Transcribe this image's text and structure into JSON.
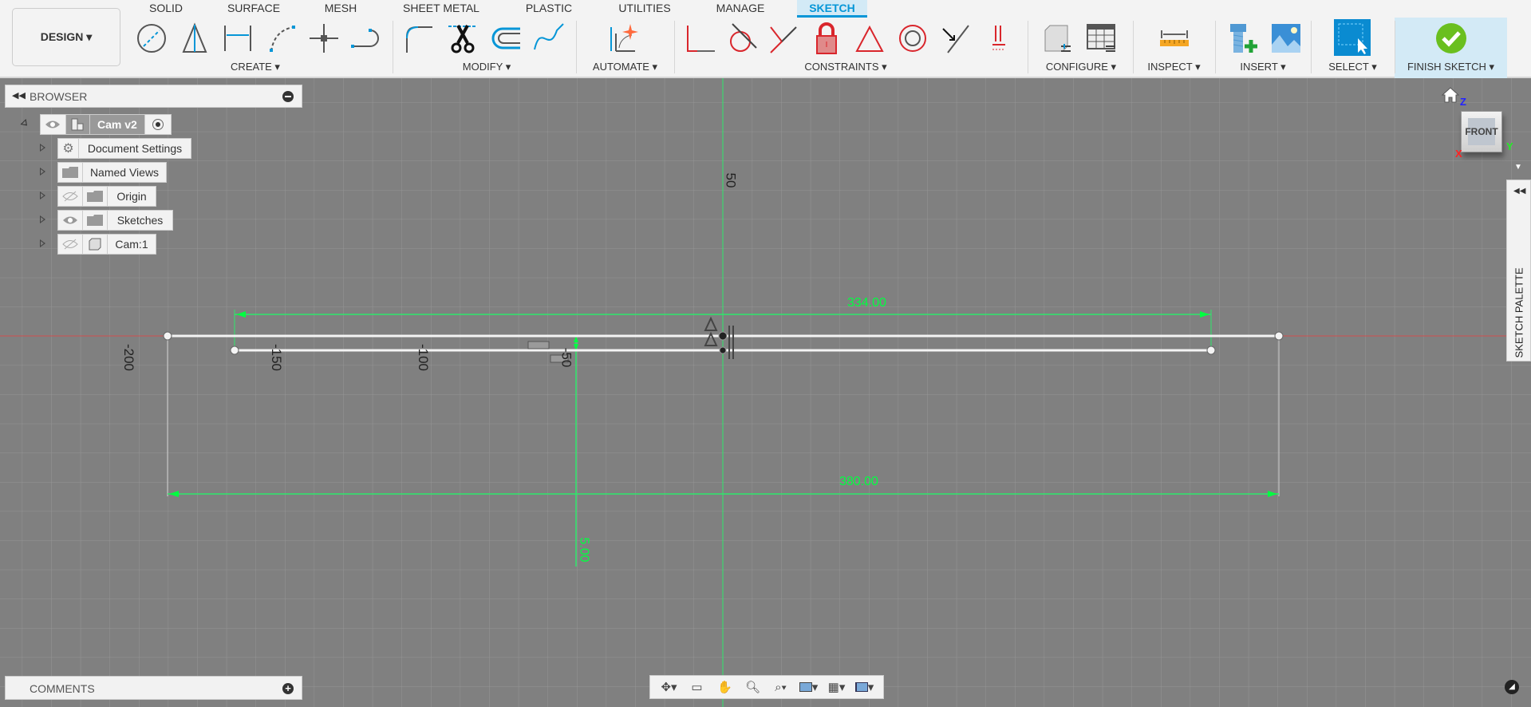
{
  "workspace_button": "DESIGN ▾",
  "tabs": [
    {
      "label": "SOLID"
    },
    {
      "label": "SURFACE"
    },
    {
      "label": "MESH"
    },
    {
      "label": "SHEET METAL"
    },
    {
      "label": "PLASTIC"
    },
    {
      "label": "UTILITIES"
    },
    {
      "label": "MANAGE"
    },
    {
      "label": "SKETCH",
      "active": true
    }
  ],
  "groups": {
    "create": "CREATE ▾",
    "modify": "MODIFY ▾",
    "automate": "AUTOMATE ▾",
    "constraints": "CONSTRAINTS ▾",
    "configure": "CONFIGURE ▾",
    "inspect": "INSPECT ▾",
    "insert": "INSERT ▾",
    "select": "SELECT ▾",
    "finish": "FINISH SKETCH ▾"
  },
  "colors": {
    "accent": "#0696d7",
    "constraint": "#d9262c",
    "dimension": "#00ff40",
    "canvas": "#808080",
    "finish": "#6abf1f"
  },
  "browser": {
    "title": "BROWSER",
    "root": "Cam v2",
    "items": [
      {
        "label": "Document Settings",
        "icon": "gear-icon"
      },
      {
        "label": "Named Views",
        "icon": "folder-icon"
      },
      {
        "label": "Origin",
        "icon": "folder-icon",
        "visibility": "hidden"
      },
      {
        "label": "Sketches",
        "icon": "folder-icon",
        "visibility": "visible"
      },
      {
        "label": "Cam:1",
        "icon": "body-icon",
        "visibility": "hidden"
      }
    ]
  },
  "comments": {
    "title": "COMMENTS"
  },
  "viewcube": {
    "face": "FRONT",
    "x": "X",
    "y": "Y",
    "z": "Z"
  },
  "sketch_palette": "SKETCH PALETTE",
  "sketch": {
    "axis_labels": {
      "v50": "50",
      "h_200": "-200",
      "h_150": "-150",
      "h_100": "-100",
      "h_50": "-50"
    },
    "dimensions": {
      "inner_length": "334.00",
      "outer_length": "380.00",
      "offset": "5.00"
    }
  }
}
